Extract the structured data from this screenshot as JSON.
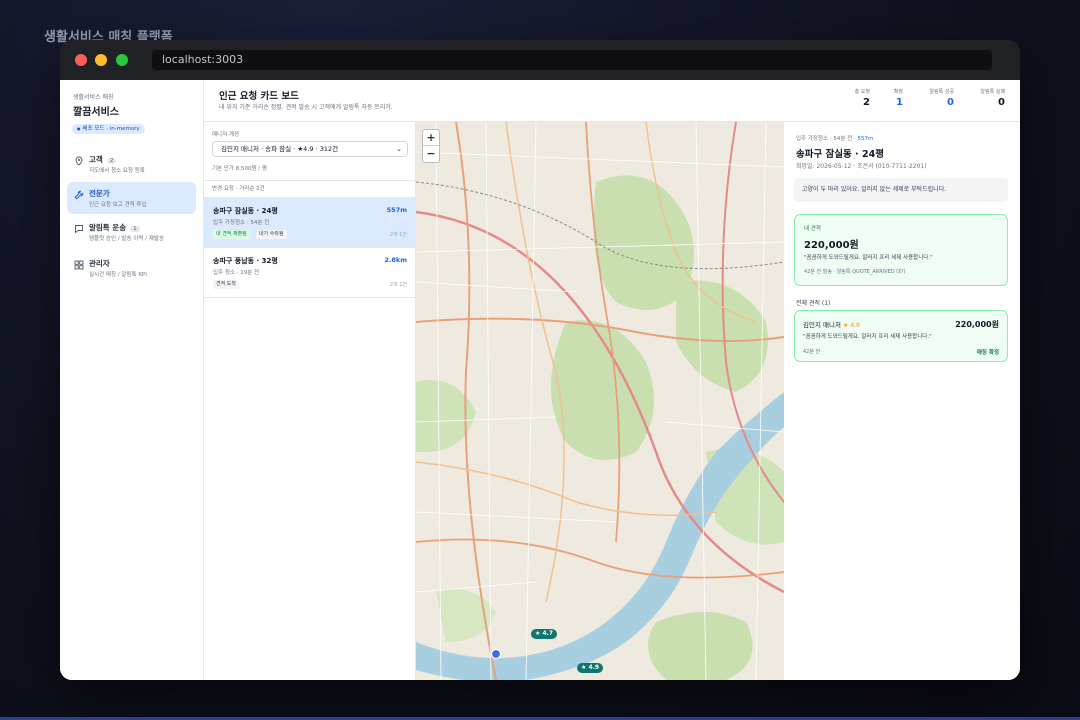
{
  "app_title": "생활서비스 매칭 플랫폼",
  "browser": {
    "url": "localhost:3003"
  },
  "sidebar": {
    "brand_sub": "생활서비스 매칭",
    "brand_title": "깔끔서비스",
    "env_badge": "배포 모드 · in-memory",
    "items": [
      {
        "label": "고객",
        "count": "2",
        "desc": "지도에서 청소 요청 등록"
      },
      {
        "label": "전문가",
        "desc": "인근 요청 보고 견적 투입"
      },
      {
        "label": "알림톡 운송",
        "count": "1",
        "desc": "템플릿 승인 / 발송 이력 / 재발송"
      },
      {
        "label": "관리자",
        "desc": "실시간 매칭 / 알림톡 KPI"
      }
    ]
  },
  "header": {
    "title": "인근 요청 카드 보드",
    "subtitle": "내 위치 기준 거리순 정렬. 견적 발송 시 고객에게 알림톡 자동 트리거.",
    "kpis": [
      {
        "label": "총 요청",
        "value": "2"
      },
      {
        "label": "확정",
        "value": "1"
      },
      {
        "label": "알림톡 성공",
        "value": "0"
      },
      {
        "label": "알림톡 실패",
        "value": "0"
      }
    ]
  },
  "list_panel": {
    "manager_label": "매니저 계정",
    "manager_select": "김민지 매니저 · 송파 잠실 · ★4.9 · 312건",
    "price_note": "기본 단가 8,500원 / 평",
    "list_header": "반경 요청 · 거리순 2건",
    "requests": [
      {
        "title": "송파구 잠실동 · 24평",
        "distance": "557m",
        "subtitle": "입주 가정청소 · 54분 전",
        "tags": [
          "내 견적 제출됨",
          "내가 수락됨"
        ],
        "time": "2개 1건"
      },
      {
        "title": "송파구 풍납동 · 32평",
        "distance": "2.8km",
        "subtitle": "입주 청소 · 19분 전",
        "tags": [
          "견적 도착"
        ],
        "time": "2개 1건"
      }
    ]
  },
  "map": {
    "zoom_in": "+",
    "zoom_out": "−",
    "markers": [
      {
        "label": "★ 4.7"
      },
      {
        "label": "★ 4.9"
      }
    ],
    "road_colors": {
      "major": "#e8a07a",
      "highway": "#e48a8a",
      "minor": "#ffffff",
      "river": "#a8cfe0",
      "park": "#c9dfb0"
    }
  },
  "detail": {
    "meta_type": "입주 가정청소",
    "meta_time": "54분 전",
    "meta_distance": "557m",
    "title": "송파구 잠실동 · 24평",
    "date_line": "희망일: 2026-05-12 · 조은서 (010-7711-2201)",
    "note": "고양이 두 마리 있어요. 알러지 없는 세제로 부탁드립니다.",
    "my_quote": {
      "label": "내 견적",
      "amount": "220,000원",
      "message": "\"꼼꼼하게 도와드릴게요. 알러지 프리 세제 사용합니다.\"",
      "status": "42분 전 발송 · 알림톡 QUOTE_ARRIVED 대기"
    },
    "all_quotes_label": "전체 견적 (1)",
    "quotes": [
      {
        "name": "김민지 매니저",
        "rating": "★ 4.9",
        "amount": "220,000원",
        "message": "\"꼼꼼하게 도와드릴게요. 알러지 프리 세제 사용합니다.\"",
        "time": "42분 전",
        "status": "매칭 확정"
      }
    ]
  }
}
